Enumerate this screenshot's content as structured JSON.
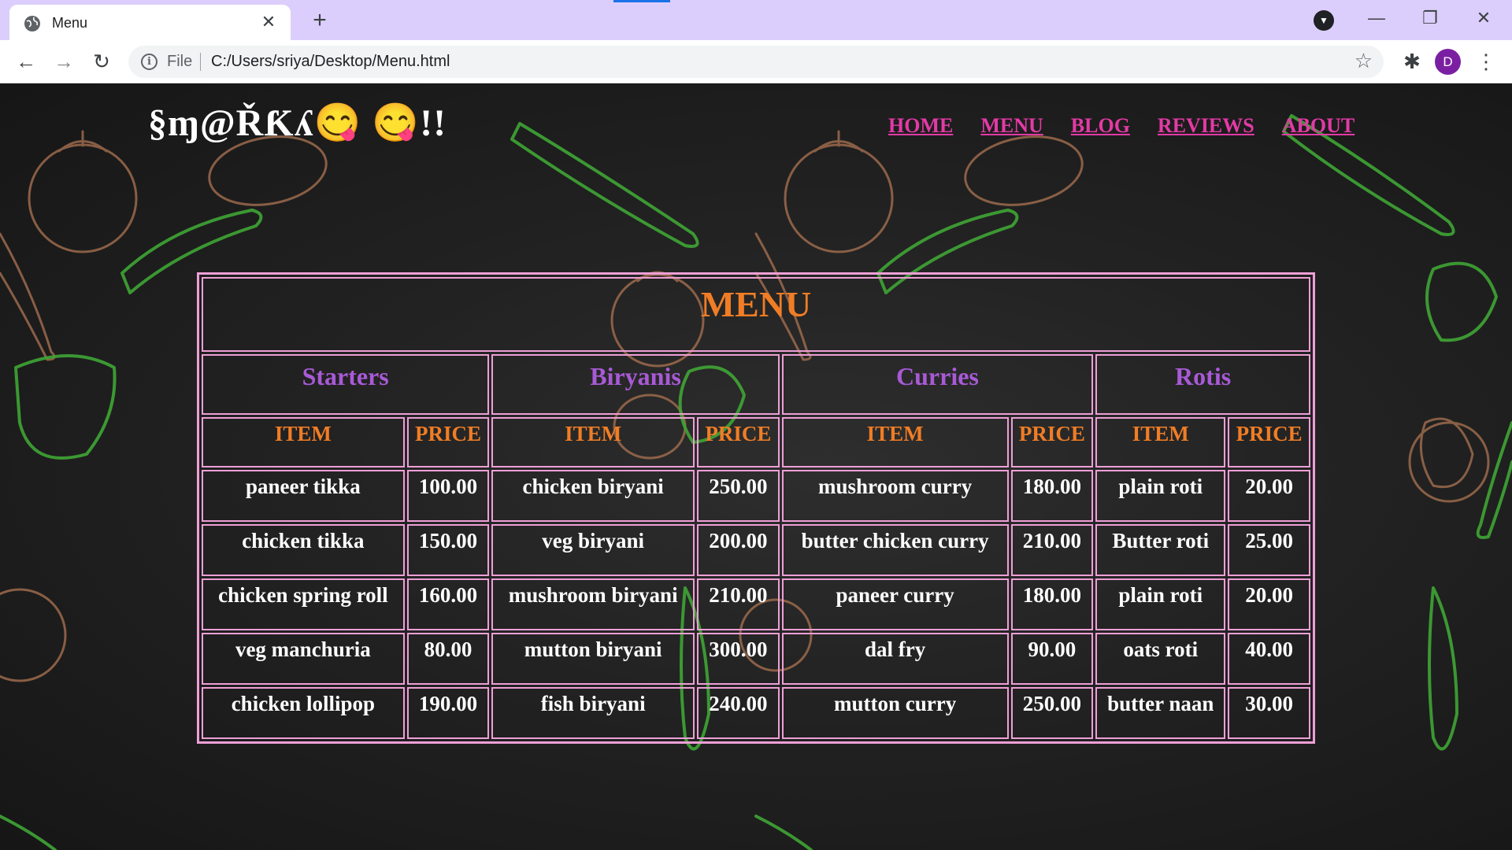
{
  "browser": {
    "tab_title": "Menu",
    "file_label": "File",
    "url": "C:/Users/sriya/Desktop/Menu.html",
    "profile_initial": "D"
  },
  "site": {
    "brand": "§ɱ@ŘƘʎ😋 😋!!",
    "nav": [
      "HOME",
      "MENU",
      "BLOG",
      "REVIEWS",
      "ABOUT"
    ]
  },
  "menu": {
    "title": "MENU",
    "categories": [
      "Starters",
      "Biryanis",
      "Curries",
      "Rotis"
    ],
    "item_header": "ITEM",
    "price_header": "PRICE",
    "rows": [
      [
        "paneer tikka",
        "100.00",
        "chicken biryani",
        "250.00",
        "mushroom curry",
        "180.00",
        "plain roti",
        "20.00"
      ],
      [
        "chicken tikka",
        "150.00",
        "veg biryani",
        "200.00",
        "butter chicken curry",
        "210.00",
        "Butter roti",
        "25.00"
      ],
      [
        "chicken spring roll",
        "160.00",
        "mushroom biryani",
        "210.00",
        "paneer curry",
        "180.00",
        "plain roti",
        "20.00"
      ],
      [
        "veg manchuria",
        "80.00",
        "mutton biryani",
        "300.00",
        "dal fry",
        "90.00",
        "oats roti",
        "40.00"
      ],
      [
        "chicken lollipop",
        "190.00",
        "fish biryani",
        "240.00",
        "mutton curry",
        "250.00",
        "butter naan",
        "30.00"
      ]
    ]
  }
}
